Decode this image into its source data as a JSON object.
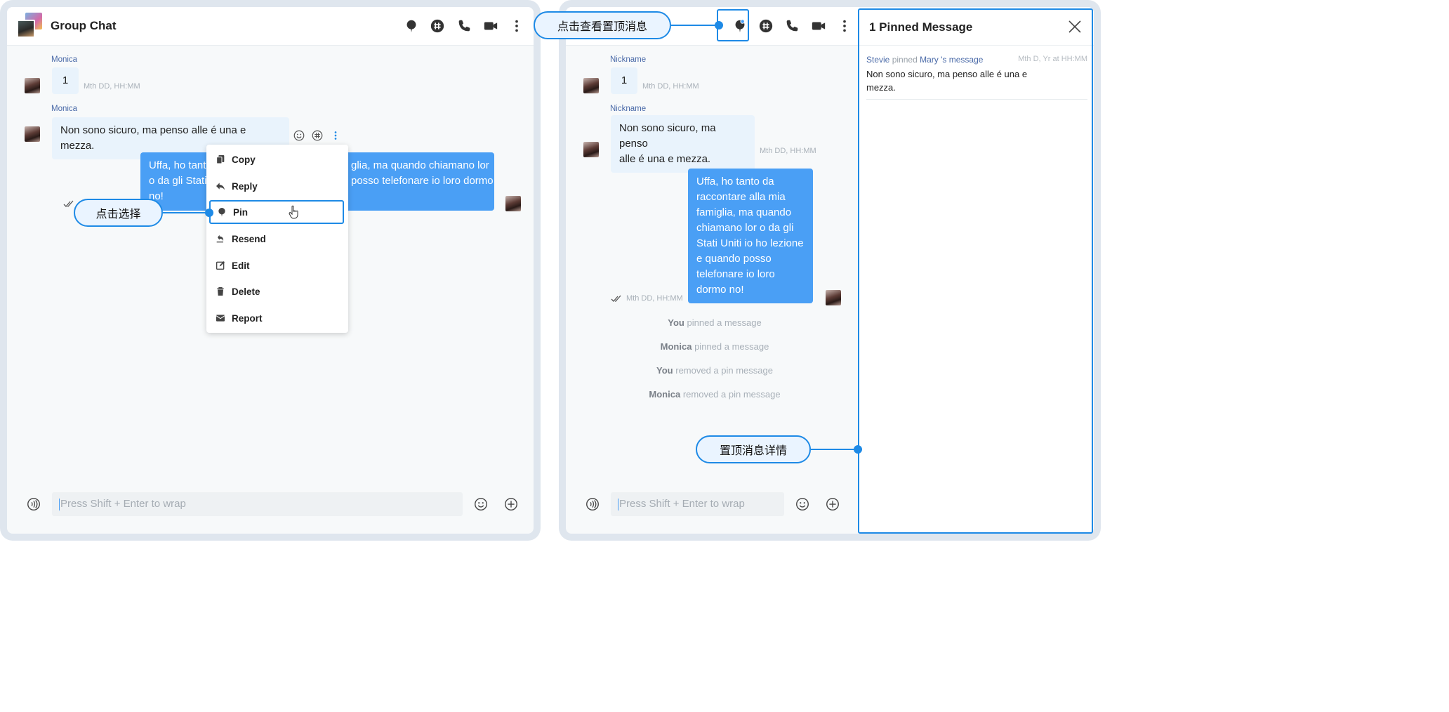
{
  "left": {
    "header": {
      "title": "Group Chat"
    },
    "messages": [
      {
        "sender": "Monica",
        "text": "1",
        "time": "Mth DD, HH:MM"
      },
      {
        "sender": "Monica",
        "text": "Non sono sicuro, ma penso alle é una e mezza."
      },
      {
        "text": "Uffa, ho tanto da raccontare alla mia famiglia, ma quando chiamano lor o da gli Stati Uniti io ho lezione e quando posso telefonare io loro dormo no!",
        "visible_fragments": [
          "Uffa, ho tant",
          "glia, ma quando chiamano lor",
          "o da gli Stati",
          "posso telefonare io loro dormo",
          "no!"
        ]
      }
    ],
    "context_menu": [
      {
        "label": "Copy",
        "icon": "copy-icon"
      },
      {
        "label": "Reply",
        "icon": "reply-icon"
      },
      {
        "label": "Pin",
        "icon": "pin-icon",
        "selected": true
      },
      {
        "label": "Resend",
        "icon": "resend-icon"
      },
      {
        "label": "Edit",
        "icon": "edit-icon"
      },
      {
        "label": "Delete",
        "icon": "trash-icon"
      },
      {
        "label": "Report",
        "icon": "mail-icon"
      }
    ],
    "callout": "点击选择",
    "composer": {
      "placeholder": "Press Shift + Enter to wrap"
    }
  },
  "right": {
    "callout_top": "点击查看置顶消息",
    "callout_bottom": "置顶消息详情",
    "messages": [
      {
        "sender": "Nickname",
        "text": "1",
        "time": "Mth DD, HH:MM"
      },
      {
        "sender": "Nickname",
        "text_lines": [
          "Non sono sicuro, ma penso",
          "alle é una e mezza."
        ],
        "time": "Mth DD, HH:MM"
      },
      {
        "text_lines": [
          "Uffa, ho tanto da",
          "raccontare alla mia",
          "famiglia, ma quando",
          "chiamano lor o da gli",
          "Stati Uniti io ho lezione",
          "e quando posso",
          "telefonare io loro",
          "dormo no!"
        ],
        "time": "Mth DD, HH:MM"
      }
    ],
    "system_messages": [
      {
        "actor": "You",
        "action": "pinned a message"
      },
      {
        "actor": "Monica",
        "action": "pinned a message"
      },
      {
        "actor": "You",
        "action": "removed a pin message"
      },
      {
        "actor": "Monica",
        "action": "removed a pin message"
      }
    ],
    "composer": {
      "placeholder": "Press Shift + Enter to wrap"
    },
    "pinned_panel": {
      "title": "1 Pinned Message",
      "entry": {
        "pinner": "Stevie",
        "verb": "pinned",
        "owner": "Mary",
        "suffix": "'s message",
        "time": "Mth D, Yr at HH:MM",
        "text_lines": [
          "Non sono sicuro, ma penso alle é una e",
          "mezza."
        ]
      }
    }
  },
  "colors": {
    "accent": "#1e8ae6",
    "my_bubble": "#4a9ff5",
    "other_bubble": "#e9f3fc",
    "sender": "#4a6aa8"
  }
}
